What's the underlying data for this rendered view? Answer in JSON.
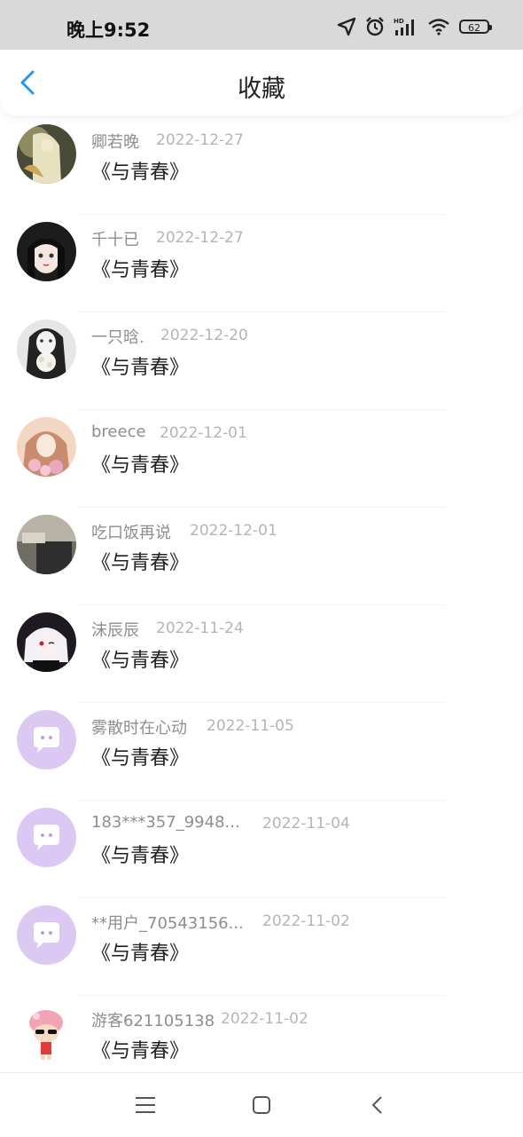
{
  "status_bar": {
    "time": "晚上9:52",
    "icons": [
      "location-icon",
      "alarm-icon",
      "signal-hd-icon",
      "wifi-icon",
      "battery-icon"
    ],
    "battery_level": "62"
  },
  "header": {
    "title": "收藏",
    "back_icon": "chevron-left-icon",
    "accent_color": "#2196f3"
  },
  "favorites": [
    {
      "user": "卿若晚",
      "date": "2022-12-27",
      "book": "《与青春》",
      "avatar": "anime-illustration-avatar"
    },
    {
      "user": "千十已",
      "date": "2022-12-27",
      "book": "《与青春》",
      "avatar": "anime-girl-dark-hair-avatar"
    },
    {
      "user": "一只晗.",
      "date": "2022-12-20",
      "book": "《与青春》",
      "avatar": "girl-with-flowers-avatar"
    },
    {
      "user": "breece",
      "date": "2022-12-01",
      "book": "《与青春》",
      "avatar": "pink-anime-girl-avatar"
    },
    {
      "user": "吃口饭再说",
      "date": "2022-12-01",
      "book": "《与青春》",
      "avatar": "photo-avatar"
    },
    {
      "user": "沫辰辰",
      "date": "2022-11-24",
      "book": "《与青春》",
      "avatar": "white-hair-anime-avatar"
    },
    {
      "user": "雾散时在心动",
      "date": "2022-11-05",
      "book": "《与青春》",
      "avatar": "default-chat-bubble-avatar"
    },
    {
      "user": "183***357_9948...",
      "date": "2022-11-04",
      "book": "《与青春》",
      "avatar": "default-chat-bubble-avatar"
    },
    {
      "user": "**用户_70543156...",
      "date": "2022-11-02",
      "book": "《与青春》",
      "avatar": "default-chat-bubble-avatar"
    },
    {
      "user": "游客621105138",
      "date": "2022-11-02",
      "book": "《与青春》",
      "avatar": "pink-mascot-avatar"
    }
  ],
  "nav_bar": {
    "menu_icon": "menu-icon",
    "home_icon": "home-square-icon",
    "back_icon": "back-chevron-icon"
  }
}
